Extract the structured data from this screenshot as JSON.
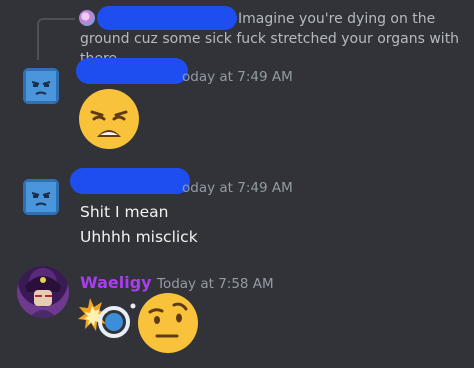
{
  "reply": {
    "text": "Imagine you're dying on the ground cuz some sick fuck stretched your organs with there"
  },
  "messages": [
    {
      "timestamp": "oday at 7:49 AM",
      "emoji": "weary-face"
    },
    {
      "timestamp": "oday at 7:49 AM",
      "lines": [
        "Shit I mean",
        "Uhhhh misclick"
      ]
    },
    {
      "username": "Waeligy",
      "timestamp": "Today at 7:58 AM",
      "emojis": [
        "collision-blue-circle",
        "face-with-raised-eyebrow"
      ]
    }
  ],
  "colors": {
    "background": "#313338",
    "redaction": "#1f4ef0",
    "username": "#a93df3",
    "timestamp": "#949ba4"
  }
}
